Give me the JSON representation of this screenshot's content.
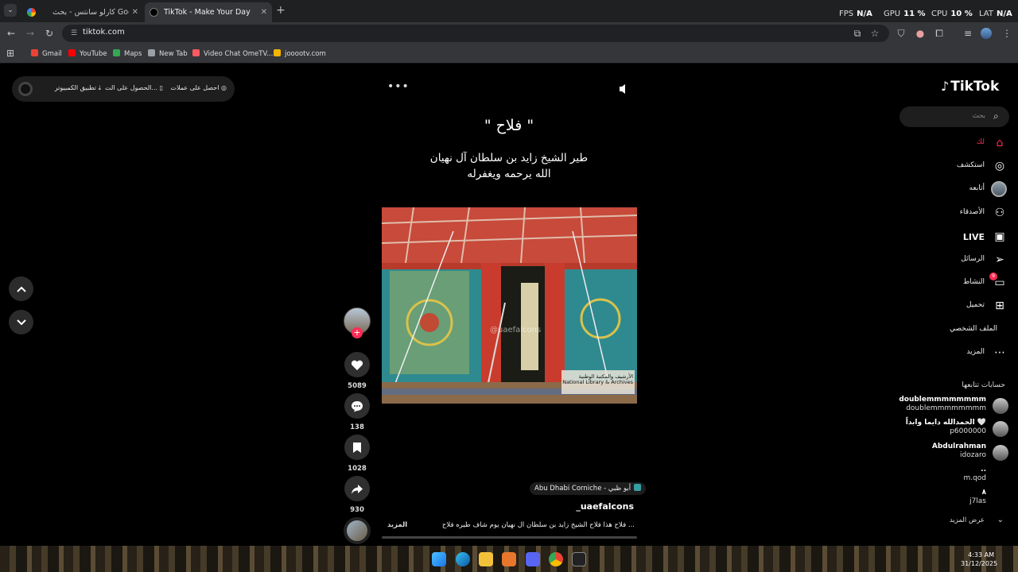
{
  "browser": {
    "tabs": [
      {
        "title": "كارلو سانتس - بحث Google",
        "active": false
      },
      {
        "title": "TikTok - Make Your Day",
        "active": true
      }
    ],
    "url": "tiktok.com",
    "perf": [
      {
        "label": "FPS",
        "value": "N/A"
      },
      {
        "label": "GPU",
        "value": "11 %"
      },
      {
        "label": "CPU",
        "value": "10 %"
      },
      {
        "label": "LAT",
        "value": "N/A"
      }
    ],
    "bookmarks": [
      {
        "label": "Gmail",
        "color": "#ea4335"
      },
      {
        "label": "YouTube",
        "color": "#ff0000"
      },
      {
        "label": "Maps",
        "color": "#34a853"
      },
      {
        "label": "New Tab",
        "color": "#9aa0a6"
      },
      {
        "label": "Video Chat OmeTV...",
        "color": "#ff5a5f"
      },
      {
        "label": "jooootv.com",
        "color": "#f4b400"
      }
    ]
  },
  "promo": {
    "items": [
      "احصل على عملات",
      "الحصول على الت...",
      "تطبيق الكمبيوتر"
    ]
  },
  "post": {
    "heading": "\" فلاح \"",
    "subheading_line1": "طير الشيخ زايد بن سلطان آل نهيان",
    "subheading_line2": "الله يرحمه ويغفرله",
    "watermark": "@uaefalcons",
    "video_logo": "الأرشيف والمكتبة الوطنية National Library & Archives",
    "likes": "5089",
    "comments": "138",
    "saves": "1028",
    "shares": "930",
    "location": "Abu Dhabi Corniche - أبو ظبي",
    "username": "_uaefalcons",
    "caption": "فلاح هذا فلاح الشيخ زايد بن سلطان آل نهيان يوم شاف طيره فلاح ...",
    "caption_more": "المزيد",
    "progress_fraction": 0.0
  },
  "sidebar": {
    "logo": "TikTok",
    "search_placeholder": "بحث",
    "nav": [
      {
        "label": "لك",
        "icon": "home-icon",
        "active": true
      },
      {
        "label": "استكشف",
        "icon": "compass-icon",
        "active": false
      },
      {
        "label": "أتابعه",
        "icon": "following-avatar-icon",
        "active": false
      },
      {
        "label": "الأصدقاء",
        "icon": "friends-icon",
        "active": false
      },
      {
        "label": "LIVE",
        "icon": "live-icon",
        "active": false
      },
      {
        "label": "الرسائل",
        "icon": "messages-icon",
        "active": false
      },
      {
        "label": "النشاط",
        "icon": "activity-icon",
        "active": false,
        "badge": "9"
      },
      {
        "label": "تحميل",
        "icon": "upload-icon",
        "active": false
      },
      {
        "label": "الملف الشخصي",
        "icon": "profile-icon",
        "active": false
      },
      {
        "label": "المزيد",
        "icon": "more-icon",
        "active": false
      }
    ],
    "following_title": "حسابات تتابعها",
    "accounts": [
      {
        "name": "doublemmmmmmmm",
        "handle": "doublemmmmmmmm"
      },
      {
        "name": "الحمدالله دايما وابداً 🤍",
        "handle": "p6000000"
      },
      {
        "name": "Abdulrahman",
        "handle": "idozaro"
      },
      {
        "name": "..",
        "handle": "m.qod"
      },
      {
        "name": "٨",
        "handle": "j7las"
      }
    ],
    "see_more": "عرض المزيد"
  },
  "taskbar": {
    "time": "4:33 AM",
    "date": "31/12/2025"
  }
}
